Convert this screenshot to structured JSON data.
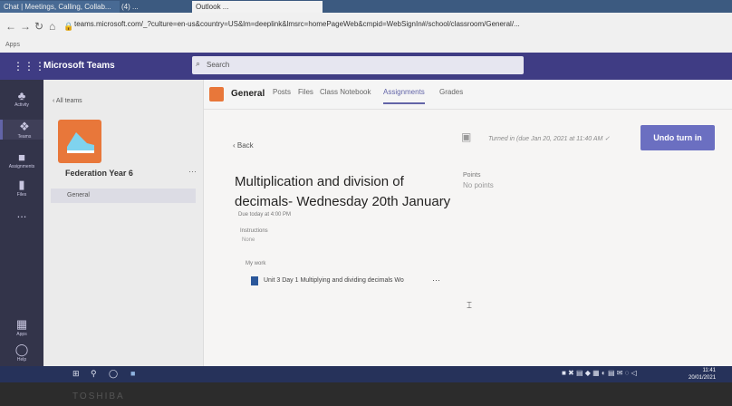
{
  "browser": {
    "tabs": [
      "Chat | Meetings, Calling, Collab...",
      "(4) ...",
      "Outlook ..."
    ],
    "url": "teams.microsoft.com/_?culture=en-us&country=US&lm=deeplink&lmsrc=homePageWeb&cmpid=WebSignIn#/school/classroom/General/...",
    "bookmarks_label": "Apps"
  },
  "teams": {
    "app_title": "Microsoft Teams",
    "search_placeholder": "Search"
  },
  "rail": [
    {
      "label": "Activity",
      "icon": "bell-icon"
    },
    {
      "label": "Teams",
      "icon": "teams-icon"
    },
    {
      "label": "Assignments",
      "icon": "assignments-icon"
    },
    {
      "label": "Files",
      "icon": "files-icon"
    },
    {
      "label": "...",
      "icon": "more-icon"
    },
    {
      "label": "Apps",
      "icon": "apps-icon"
    },
    {
      "label": "Help",
      "icon": "help-icon"
    }
  ],
  "panel": {
    "all_teams": "All teams",
    "team_name": "Federation Year 6",
    "channel": "General"
  },
  "channel": {
    "title": "General",
    "tabs": [
      "Posts",
      "Files",
      "Class Notebook",
      "Assignments",
      "Grades"
    ],
    "active_tab": "Assignments"
  },
  "assignment": {
    "back": "Back",
    "status": "Turned in (due Jan 20, 2021 at 11:40 AM",
    "undo_button": "Undo turn in",
    "title": "Multiplication and division of decimals- Wednesday 20th January",
    "due": "Due today at 4:00 PM",
    "instructions_heading": "Instructions",
    "instructions_value": "None",
    "points_heading": "Points",
    "points_value": "No points",
    "my_work_heading": "My work",
    "work_file": "Unit 3 Day 1 Multiplying and dividing decimals Wo"
  },
  "taskbar": {
    "time": "11:41",
    "date": "20/01/2021"
  },
  "bezel_brand": "TOSHIBA"
}
